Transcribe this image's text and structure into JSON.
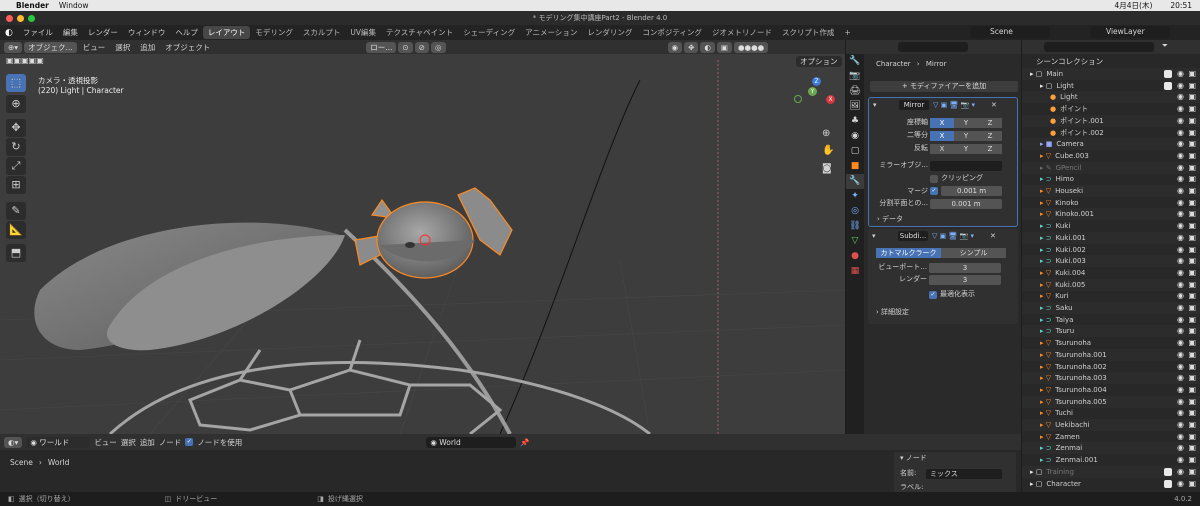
{
  "mac": {
    "app": "Blender",
    "window_menu": "Window",
    "date": "4月4日(木)",
    "time": "20:51"
  },
  "title": "* モデリング集中講座Part2 - Blender 4.0",
  "menus": [
    "ファイル",
    "編集",
    "レンダー",
    "ウィンドウ",
    "ヘルプ"
  ],
  "workspaces": [
    "レイアウト",
    "モデリング",
    "スカルプト",
    "UV編集",
    "テクスチャペイント",
    "シェーディング",
    "アニメーション",
    "レンダリング",
    "コンポジティング",
    "ジオメトリノード",
    "スクリプト作成"
  ],
  "scene_label": "Scene",
  "viewlayer_label": "ViewLayer",
  "viewport": {
    "mode": "オブジェク...",
    "menus": [
      "ビュー",
      "選択",
      "追加",
      "オブジェクト"
    ],
    "orientation": "ロー...",
    "overlay_title": "カメラ・透視投影",
    "overlay_sub": "(220) Light | Character",
    "options": "オプション",
    "axes": {
      "x": "X",
      "y": "Y",
      "z": "Z"
    }
  },
  "properties": {
    "breadcrumb_obj": "Character",
    "breadcrumb_mod": "Mirror",
    "add_modifier": "モディファイアーを追加",
    "mirror": {
      "name": "Mirror",
      "axis_label": "座標軸",
      "bisect_label": "二等分",
      "flip_label": "反転",
      "xyz": [
        "X",
        "Y",
        "Z"
      ],
      "mirror_object": "ミラーオブジ...",
      "clipping": "クリッピング",
      "merge_label": "マージ",
      "merge_value": "0.001 m",
      "bisect_dist_label": "分割平面との...",
      "bisect_dist_value": "0.001 m",
      "data": "データ"
    },
    "subdiv": {
      "name": "Subdi...",
      "catmull": "カトマルクラーク",
      "simple": "シンプル",
      "viewport_label": "ビューポート...",
      "viewport_value": "3",
      "render_label": "レンダー",
      "render_value": "3",
      "optimal": "最適化表示",
      "advanced": "詳細設定"
    }
  },
  "outliner": {
    "header": "シーンコレクション",
    "rows": [
      {
        "label": "Main",
        "indent": 0,
        "kind": "collection"
      },
      {
        "label": "Light",
        "indent": 1,
        "kind": "collection"
      },
      {
        "label": "Light",
        "indent": 2,
        "kind": "light"
      },
      {
        "label": "ポイント",
        "indent": 2,
        "kind": "light"
      },
      {
        "label": "ポイント.001",
        "indent": 2,
        "kind": "light"
      },
      {
        "label": "ポイント.002",
        "indent": 2,
        "kind": "light"
      },
      {
        "label": "Camera",
        "indent": 1,
        "kind": "camera"
      },
      {
        "label": "Cube.003",
        "indent": 1,
        "kind": "mesh"
      },
      {
        "label": "GPencil",
        "indent": 1,
        "kind": "gpencil"
      },
      {
        "label": "Himo",
        "indent": 1,
        "kind": "curve"
      },
      {
        "label": "Houseki",
        "indent": 1,
        "kind": "mesh"
      },
      {
        "label": "Kinoko",
        "indent": 1,
        "kind": "mesh"
      },
      {
        "label": "Kinoko.001",
        "indent": 1,
        "kind": "mesh"
      },
      {
        "label": "Kuki",
        "indent": 1,
        "kind": "curve"
      },
      {
        "label": "Kuki.001",
        "indent": 1,
        "kind": "curve"
      },
      {
        "label": "Kuki.002",
        "indent": 1,
        "kind": "curve"
      },
      {
        "label": "Kuki.003",
        "indent": 1,
        "kind": "curve"
      },
      {
        "label": "Kuki.004",
        "indent": 1,
        "kind": "mesh"
      },
      {
        "label": "Kuki.005",
        "indent": 1,
        "kind": "mesh"
      },
      {
        "label": "Kuri",
        "indent": 1,
        "kind": "mesh"
      },
      {
        "label": "Saku",
        "indent": 1,
        "kind": "curve"
      },
      {
        "label": "Taiya",
        "indent": 1,
        "kind": "curve"
      },
      {
        "label": "Tsuru",
        "indent": 1,
        "kind": "curve"
      },
      {
        "label": "Tsurunoha",
        "indent": 1,
        "kind": "mesh"
      },
      {
        "label": "Tsurunoha.001",
        "indent": 1,
        "kind": "mesh"
      },
      {
        "label": "Tsurunoha.002",
        "indent": 1,
        "kind": "mesh"
      },
      {
        "label": "Tsurunoha.003",
        "indent": 1,
        "kind": "mesh"
      },
      {
        "label": "Tsurunoha.004",
        "indent": 1,
        "kind": "mesh"
      },
      {
        "label": "Tsurunoha.005",
        "indent": 1,
        "kind": "mesh"
      },
      {
        "label": "Tuchi",
        "indent": 1,
        "kind": "mesh"
      },
      {
        "label": "Uekibachi",
        "indent": 1,
        "kind": "mesh"
      },
      {
        "label": "Zamen",
        "indent": 1,
        "kind": "mesh"
      },
      {
        "label": "Zenmai",
        "indent": 1,
        "kind": "curve"
      },
      {
        "label": "Zenmai.001",
        "indent": 1,
        "kind": "curve"
      },
      {
        "label": "Training",
        "indent": 0,
        "kind": "collection"
      },
      {
        "label": "Character",
        "indent": 0,
        "kind": "collection"
      }
    ]
  },
  "node_editor": {
    "world_menu": "ワールド",
    "menus": [
      "ビュー",
      "選択",
      "追加",
      "ノード"
    ],
    "use_nodes": "ノードを使用",
    "world_name": "World",
    "breadcrumb_scene": "Scene",
    "breadcrumb_world": "World",
    "panel_title": "ノード",
    "name_label": "名前:",
    "name_value": "ミックス",
    "label_label": "ラベル:"
  },
  "status": {
    "select": "選択（切り替え）",
    "dolly": "ドリービュー",
    "lasso": "投げ縄選択",
    "version": "4.0.2"
  }
}
